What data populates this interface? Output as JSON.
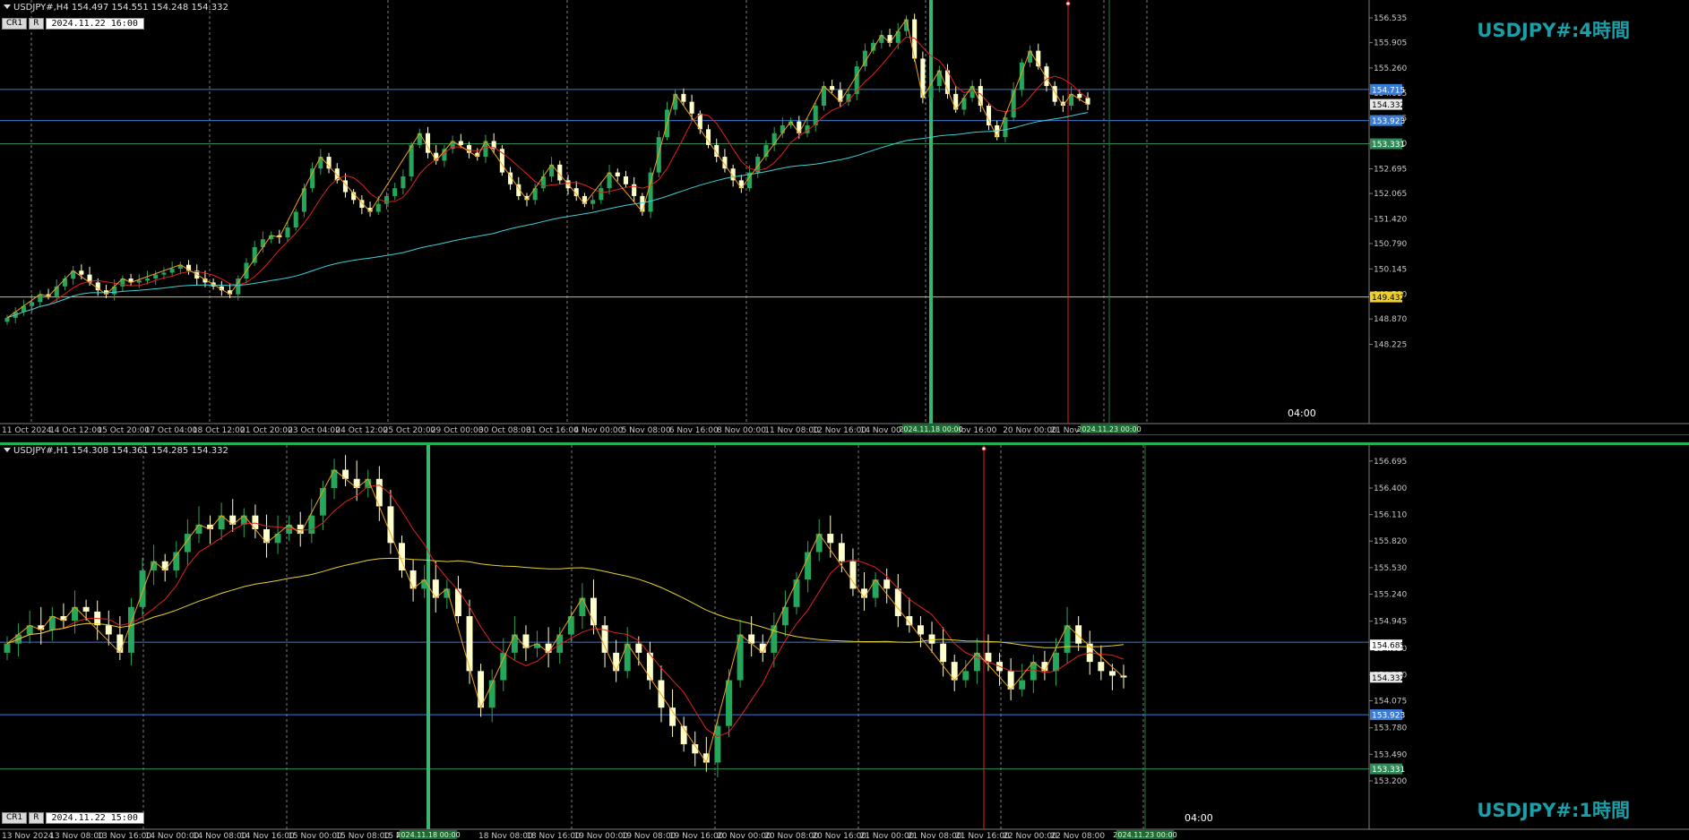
{
  "colors": {
    "bull": "#26a65b",
    "bear": "#ffffcc",
    "grid": "#808080",
    "ma_fast": "#e02020",
    "ma_slow_h4": "#3fd0d8",
    "ma_slow_h1": "#e8d030",
    "zigzag": "#f0a020",
    "hline_blue": "#3a7bd5",
    "hline_green": "#2e8b57",
    "hline_yellow": "#e8c020",
    "green_vline": "#3cb371",
    "red_vline": "#e02020"
  },
  "panes": [
    {
      "id": "h4",
      "header_text": "USDJPY#,H4  154.497 154.551 154.248 154.332",
      "cr_label": "CR1",
      "r_label": "R",
      "datetime": "2024.11.22 16:00",
      "title": "USDJPY#:4時間",
      "time_marker": "04:00",
      "price_ticks": [
        "156.535",
        "155.905",
        "155.260",
        "154.615",
        "153.985",
        "153.340",
        "152.695",
        "152.065",
        "151.420",
        "150.790",
        "150.145",
        "149.500",
        "148.870",
        "148.225"
      ],
      "tag_labels": [
        {
          "text": "154.715",
          "kind": "blue",
          "price": 154.715
        },
        {
          "text": "154.332",
          "kind": "white",
          "price": 154.332
        },
        {
          "text": "153.923",
          "kind": "blue",
          "price": 153.923
        },
        {
          "text": "153.331",
          "kind": "green",
          "price": 153.331
        },
        {
          "text": "149.432",
          "kind": "yellow",
          "price": 149.432
        }
      ],
      "time_labels": [
        "11 Oct 2024",
        "14 Oct 12:00",
        "15 Oct 20:00",
        "17 Oct 04:00",
        "18 Oct 12:00",
        "21 Oct 20:00",
        "23 Oct 04:00",
        "24 Oct 12:00",
        "25 Oct 20:00",
        "29 Oct 00:00",
        "30 Oct 08:00",
        "31 Oct 16:00",
        "4 Nov 00:00",
        "5 Nov 08:00",
        "6 Nov 16:00",
        "8 Nov 00:00",
        "11 Nov 08:00",
        "12 Nov 16:00",
        "14 Nov 00:00",
        "",
        "Nov 16:00",
        "20 Nov 00:00",
        "21 Nov 0"
      ],
      "time_tags": [
        {
          "text": "2024.11.18 00:00",
          "kind": "green_box",
          "pos": "vline_green"
        },
        {
          "text": "2024.11.23 00:00",
          "kind": "green_box",
          "pos": "vline_right"
        }
      ],
      "ylim": [
        148.1,
        156.9
      ],
      "hlines": [
        154.715,
        153.923,
        153.331,
        149.432
      ],
      "chart_data": {
        "type": "candlestick",
        "symbol": "USDJPY#",
        "timeframe": "H4",
        "closes": [
          148.9,
          149.05,
          149.2,
          149.3,
          149.5,
          149.45,
          149.7,
          149.9,
          150.1,
          150.0,
          149.8,
          149.6,
          149.5,
          149.7,
          149.9,
          149.8,
          149.85,
          149.9,
          150.0,
          150.05,
          150.15,
          150.25,
          150.1,
          149.9,
          149.8,
          149.7,
          149.6,
          149.5,
          149.9,
          150.3,
          150.7,
          150.9,
          151.0,
          150.95,
          151.2,
          151.6,
          152.2,
          152.7,
          153.0,
          152.7,
          152.4,
          152.1,
          151.9,
          151.7,
          151.6,
          151.8,
          152.0,
          152.2,
          152.5,
          153.3,
          153.6,
          153.1,
          152.9,
          153.2,
          153.4,
          153.3,
          153.1,
          153.0,
          153.4,
          153.2,
          152.6,
          152.3,
          152.0,
          151.9,
          152.2,
          152.5,
          152.8,
          152.4,
          152.2,
          152.0,
          151.8,
          151.9,
          152.2,
          152.6,
          152.5,
          152.3,
          152.0,
          151.6,
          152.6,
          153.5,
          154.2,
          154.6,
          154.4,
          154.1,
          153.7,
          153.3,
          153.0,
          152.7,
          152.4,
          152.2,
          152.6,
          153.0,
          153.3,
          153.6,
          153.8,
          153.9,
          153.6,
          153.8,
          154.3,
          154.8,
          154.7,
          154.4,
          154.6,
          155.3,
          155.7,
          155.9,
          156.1,
          155.9,
          156.2,
          156.5,
          155.5,
          154.5,
          154.8,
          155.2,
          154.6,
          154.2,
          154.5,
          154.8,
          154.3,
          153.8,
          153.5,
          154.0,
          154.7,
          155.4,
          155.7,
          155.3,
          154.8,
          154.4,
          154.3,
          154.6,
          154.5,
          154.33
        ],
        "ma_fast_label": "",
        "ma_slow_label": ""
      }
    },
    {
      "id": "h1",
      "header_text": "USDJPY#,H1  154.308 154.361 154.285 154.332",
      "cr_label": "CR1",
      "r_label": "R",
      "datetime": "2024.11.22 15:00",
      "title": "USDJPY#:1時間",
      "time_marker": "04:00",
      "price_ticks": [
        "156.695",
        "156.400",
        "156.110",
        "155.820",
        "155.530",
        "155.240",
        "154.945",
        "154.650",
        "154.360",
        "154.075",
        "153.780",
        "153.490",
        "153.200"
      ],
      "tag_labels": [
        {
          "text": "154.685",
          "kind": "blue_white",
          "price": 154.685
        },
        {
          "text": "154.332",
          "kind": "white",
          "price": 154.332
        },
        {
          "text": "153.923",
          "kind": "blue",
          "price": 153.923
        },
        {
          "text": "153.331",
          "kind": "green",
          "price": 153.331
        }
      ],
      "time_labels": [
        "13 Nov 2024",
        "13 Nov 08:00",
        "13 Nov 16:00",
        "14 Nov 00:00",
        "14 Nov 08:00",
        "14 Nov 16:00",
        "15 Nov 00:00",
        "15 Nov 08:00",
        "15 No",
        "",
        "18 Nov 08:00",
        "18 Nov 16:00",
        "19 Nov 00:00",
        "19 Nov 08:00",
        "19 Nov 16:00",
        "20 Nov 00:00",
        "20 Nov 08:00",
        "20 Nov 16:00",
        "21 Nov 00:00",
        "21 Nov 08:00",
        "21 Nov 16:00",
        "22 Nov 00:00",
        "22 Nov 08:00"
      ],
      "time_tags": [
        {
          "text": "2024.11.18 00:00",
          "kind": "green_box",
          "pos": "vline_green"
        },
        {
          "text": "2024.11.23 00:00",
          "kind": "green_box",
          "pos": "vline_right"
        }
      ],
      "ylim": [
        153.18,
        156.85
      ],
      "hlines": [
        154.715,
        153.923,
        153.331
      ],
      "chart_data": {
        "type": "candlestick",
        "symbol": "USDJPY#",
        "timeframe": "H1",
        "closes": [
          154.7,
          154.8,
          154.9,
          154.85,
          155.0,
          154.95,
          155.1,
          155.05,
          154.9,
          154.8,
          154.6,
          155.1,
          155.5,
          155.6,
          155.5,
          155.7,
          155.9,
          156.0,
          155.95,
          156.1,
          156.0,
          156.1,
          155.95,
          155.8,
          155.9,
          156.0,
          155.9,
          156.1,
          156.4,
          156.6,
          156.5,
          156.4,
          156.5,
          156.2,
          155.8,
          155.5,
          155.3,
          155.4,
          155.2,
          155.3,
          155.0,
          154.4,
          154.0,
          154.3,
          154.6,
          154.8,
          154.65,
          154.7,
          154.6,
          154.8,
          155.0,
          155.2,
          154.9,
          154.6,
          154.4,
          154.7,
          154.6,
          154.3,
          154.0,
          153.8,
          153.6,
          153.5,
          153.4,
          153.8,
          154.3,
          154.8,
          154.7,
          154.6,
          154.9,
          155.1,
          155.4,
          155.7,
          155.9,
          155.8,
          155.6,
          155.3,
          155.2,
          155.4,
          155.3,
          155.0,
          154.9,
          154.8,
          154.7,
          154.5,
          154.3,
          154.4,
          154.6,
          154.5,
          154.4,
          154.2,
          154.3,
          154.5,
          154.4,
          154.6,
          154.9,
          154.7,
          154.5,
          154.4,
          154.35,
          154.33
        ],
        "ma_fast_label": "",
        "ma_slow_label": ""
      }
    }
  ]
}
